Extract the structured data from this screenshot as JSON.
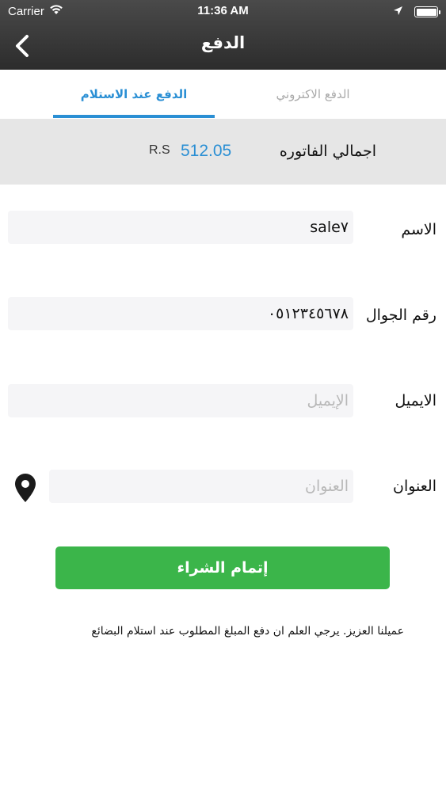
{
  "status_bar": {
    "carrier": "Carrier",
    "time": "11:36 AM"
  },
  "nav": {
    "title": "الدفع"
  },
  "tabs": {
    "online": "الدفع الاكتروني",
    "cash_on_delivery": "الدفع عند الاستلام",
    "active": "cash_on_delivery"
  },
  "invoice": {
    "label": "اجمالي الفاتوره",
    "amount": "512.05",
    "currency": "R.S"
  },
  "form": {
    "name": {
      "label": "الاسم",
      "value": "sale٧",
      "placeholder": ""
    },
    "phone": {
      "label": "رقم الجوال",
      "value": "٠٥١٢٣٤٥٦٧٨",
      "placeholder": ""
    },
    "email": {
      "label": "الايميل",
      "value": "",
      "placeholder": "الإيميل"
    },
    "address": {
      "label": "العنوان",
      "value": "",
      "placeholder": "العنوان"
    }
  },
  "buy_button": "إتمام الشراء",
  "note": "عميلنا العزيز.  يرجي العلم ان دفع  المبلغ المطلوب عند استلام البضائع",
  "colors": {
    "accent": "#2a8fd4",
    "buy_button": "#3bb54a",
    "header": "#333333"
  }
}
